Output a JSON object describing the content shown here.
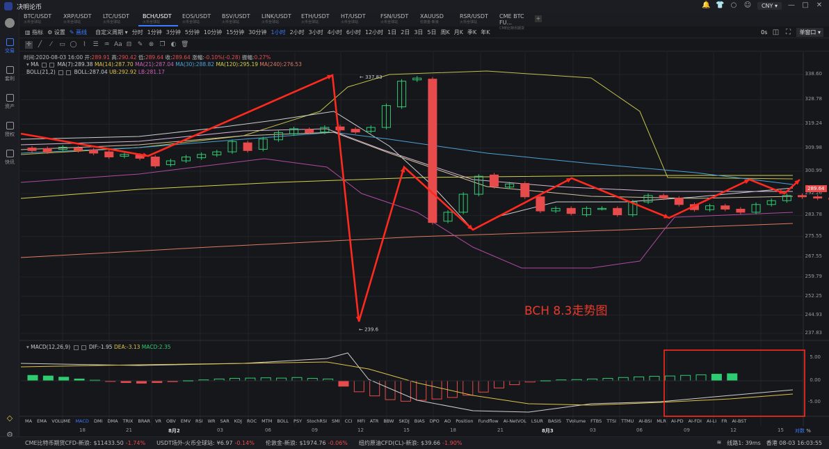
{
  "app": {
    "title": "决明论币"
  },
  "titlebar": {
    "currency": "CNY"
  },
  "sidebar": [
    {
      "label": "交易",
      "active": true
    },
    {
      "label": "套利"
    },
    {
      "label": "资产"
    },
    {
      "label": "授权"
    },
    {
      "label": "快讯"
    }
  ],
  "tabs": [
    {
      "name": "BTC/USDT",
      "sub": "火币全球站"
    },
    {
      "name": "XRP/USDT",
      "sub": "火币全球站"
    },
    {
      "name": "LTC/USDT",
      "sub": "火币全球站"
    },
    {
      "name": "BCH/USDT",
      "sub": "火币全球站",
      "active": true
    },
    {
      "name": "EOS/USDT",
      "sub": "火币全球站"
    },
    {
      "name": "BSV/USDT",
      "sub": "火币全球站"
    },
    {
      "name": "LINK/USDT",
      "sub": "火币全球站"
    },
    {
      "name": "ETH/USDT",
      "sub": "火币全球站"
    },
    {
      "name": "HT/USDT",
      "sub": "火币全球站"
    },
    {
      "name": "FSN/USDT",
      "sub": "火币全球站"
    },
    {
      "name": "XAUUSD",
      "sub": "伦敦金-新浪"
    },
    {
      "name": "RSR/USDT",
      "sub": "火币全球站"
    },
    {
      "name": "CME BTC FU...",
      "sub": "CME比特币期货"
    }
  ],
  "toolbar": {
    "indicator": "指标",
    "settings": "设置",
    "draw": "画线",
    "custom_period": "自定义周期",
    "periods": [
      "分时",
      "1分钟",
      "3分钟",
      "5分钟",
      "10分钟",
      "15分钟",
      "30分钟",
      "1小时",
      "2小时",
      "3小时",
      "4小时",
      "6小时",
      "12小时",
      "1日",
      "2日",
      "3日",
      "5日",
      "周K",
      "月K",
      "季K",
      "年K"
    ],
    "active_period": "1小时",
    "seconds": "0s",
    "window_mode": "单窗口"
  },
  "info": {
    "time_label": "时间:",
    "time": "2020-08-03 16:00",
    "open_label": "开:",
    "open": "289.91",
    "high_label": "高:",
    "high": "290.42",
    "low_label": "低:",
    "low": "289.64",
    "close_label": "收:",
    "close": "289.64",
    "change_label": "涨幅:",
    "change": "-0.10%(-0.28)",
    "amp_label": "振幅:",
    "amp": "0.27%"
  },
  "ma": {
    "title": "MA",
    "ma7": "MA(7):289.38",
    "ma14": "MA(14):287.70",
    "ma21": "MA(21):287.04",
    "ma30": "MA(30):288.82",
    "ma120": "MA(120):295.19",
    "ma240": "MA(240):276.53"
  },
  "boll": {
    "title": "BOLL(21,2)",
    "mid": "BOLL:287.04",
    "ub": "UB:292.92",
    "lb": "LB:281.17"
  },
  "price_axis": [
    "338.60",
    "328.78",
    "319.24",
    "309.98",
    "300.99",
    "292.26",
    "283.78",
    "275.55",
    "267.55",
    "259.79",
    "252.25",
    "244.93",
    "237.83"
  ],
  "last_price": "289.64",
  "markers": {
    "high": "← 337.83",
    "low": "← 239.6"
  },
  "annotation": "BCH 8.3走势图",
  "macd": {
    "title": "MACD(12,26,9)",
    "dif": "DIF:-1.95",
    "dea": "DEA:-3.13",
    "macd": "MACD:2.35",
    "axis": [
      "5.00",
      "0.00",
      "-5.00"
    ]
  },
  "indicator_tabs": [
    "MA",
    "EMA",
    "VOLUME",
    "MACD",
    "DMI",
    "DMA",
    "TRIX",
    "BRAR",
    "VR",
    "OBV",
    "EMV",
    "RSI",
    "WR",
    "SAR",
    "KDJ",
    "ROC",
    "MTM",
    "BOLL",
    "PSY",
    "StochRSI",
    "SMI",
    "CCI",
    "MFI",
    "ATR",
    "BBW",
    "SKDJ",
    "BIAS",
    "DPO",
    "AO",
    "Position",
    "Fundflow",
    "AI-NetVOL",
    "LSUR",
    "BASIS",
    "TVolume",
    "FTBS",
    "TTSI",
    "TTMU",
    "AI-BSI",
    "MLR",
    "AI-PD",
    "AI-FDI",
    "AI-LI",
    "FR",
    "AI-BST"
  ],
  "active_indicator": "MACD",
  "x_axis": [
    "18",
    "21",
    "8月2",
    "03",
    "06",
    "09",
    "12",
    "15",
    "18",
    "21",
    "8月3",
    "03",
    "06",
    "09",
    "12",
    "15"
  ],
  "scale_ctl": {
    "mode": "对数",
    "pct": "%"
  },
  "statusbar": {
    "items": [
      {
        "name": "CME比特币期货CFD-新浪:",
        "value": "$11433.50",
        "change": "-1.74%"
      },
      {
        "name": "USDT场外-火币全球站:",
        "value": "¥6.97",
        "change": "-0.14%"
      },
      {
        "name": "伦敦金-新浪:",
        "value": "$1974.76",
        "change": "-0.06%"
      },
      {
        "name": "纽约原油CFD(CL)-新浪:",
        "value": "$39.66",
        "change": "-1.90%"
      }
    ],
    "latency": "线路1: 39ms",
    "clock": "香港 08-03 16:03:55"
  },
  "chart_data": {
    "type": "candlestick",
    "symbol": "BCH/USDT",
    "interval": "1小时",
    "ylim": [
      237.83,
      338.6
    ],
    "candles": [
      [
        310.0,
        309.0
      ],
      [
        309.8,
        308.5
      ],
      [
        309.5,
        310.3
      ],
      [
        310.0,
        309.0
      ],
      [
        309.2,
        308.0
      ],
      [
        308.5,
        306.5
      ],
      [
        306.8,
        307.5
      ],
      [
        307.2,
        306.0
      ],
      [
        306.5,
        303.0
      ],
      [
        303.5,
        305.0
      ],
      [
        305.0,
        306.5
      ],
      [
        306.2,
        307.5
      ],
      [
        307.3,
        308.5
      ],
      [
        308.5,
        312.5
      ],
      [
        312.0,
        309.0
      ],
      [
        309.5,
        313.5
      ],
      [
        313.2,
        316.0
      ],
      [
        315.5,
        317.5
      ],
      [
        317.2,
        316.0
      ],
      [
        316.2,
        318.0
      ],
      [
        318.2,
        317.0
      ],
      [
        317.3,
        316.2
      ],
      [
        316.5,
        318.0
      ],
      [
        318.0,
        326.5
      ],
      [
        326.0,
        336.0
      ],
      [
        336.5,
        337.2
      ],
      [
        336.8,
        281.0
      ],
      [
        281.5,
        285.0
      ],
      [
        285.0,
        292.0
      ],
      [
        292.0,
        299.0
      ],
      [
        299.5,
        295.0
      ],
      [
        294.8,
        296.0
      ],
      [
        296.2,
        291.0
      ],
      [
        291.0,
        285.5
      ],
      [
        285.5,
        286.5
      ],
      [
        286.5,
        284.5
      ],
      [
        284.0,
        286.5
      ],
      [
        286.5,
        286.5
      ],
      [
        286.5,
        284.0
      ],
      [
        284.0,
        289.0
      ],
      [
        289.0,
        291.5
      ],
      [
        291.5,
        290.5
      ],
      [
        290.5,
        288.0
      ],
      [
        288.0,
        286.0
      ],
      [
        286.0,
        287.5
      ],
      [
        287.5,
        286.2
      ],
      [
        286.2,
        285.0
      ],
      [
        285.0,
        288.0
      ],
      [
        288.0,
        289.5
      ],
      [
        289.5,
        291.5
      ],
      [
        291.5,
        291.0
      ],
      [
        291.0,
        290.5
      ],
      [
        290.5,
        290.0
      ],
      [
        290.0,
        289.64
      ]
    ],
    "macd_hist": [
      1.8,
      1.6,
      1.2,
      0.6,
      0.2,
      -0.1,
      -0.6,
      -0.8,
      -0.6,
      -0.3,
      0.1,
      0.3,
      0.6,
      0.8,
      0.9,
      1.0,
      0.9,
      1.1,
      0.8,
      0.6,
      -1.8,
      -3.5,
      -4.8,
      -6.0,
      -6.5,
      -6.2,
      -5.8,
      -5.3,
      -4.6,
      -3.6,
      -2.4,
      -1.3,
      -0.4,
      0.1,
      0.3,
      0.4,
      0.6,
      0.8,
      1.1,
      1.3,
      1.5,
      1.6,
      1.8,
      2.0,
      2.2,
      2.35
    ]
  }
}
